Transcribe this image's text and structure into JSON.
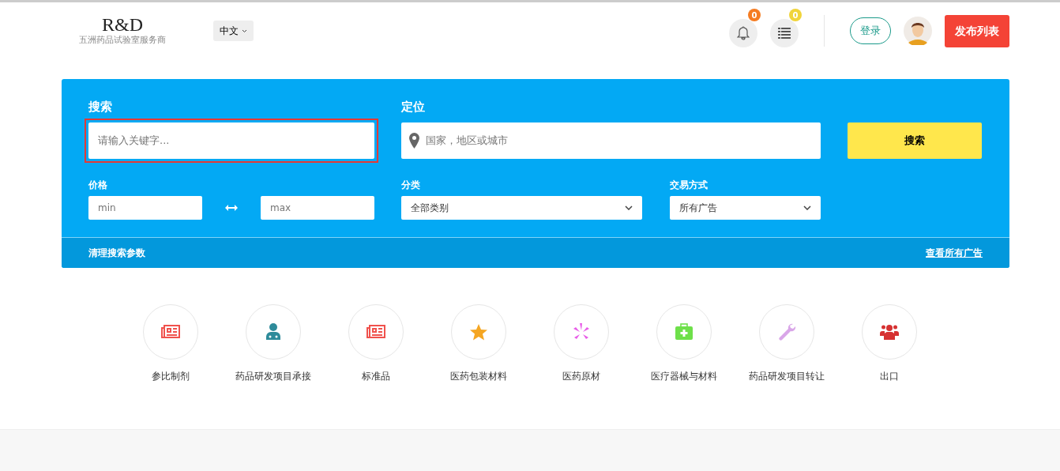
{
  "header": {
    "logo": "R&D",
    "tagline": "五洲药品试验室服务商",
    "language": "中文",
    "notifications": [
      {
        "kind": "bell",
        "count": "0",
        "color": "#f57c22"
      },
      {
        "kind": "list",
        "count": "0",
        "color": "#f0d43a"
      }
    ],
    "login": "登录",
    "publish": "发布列表"
  },
  "search": {
    "keyword_label": "搜索",
    "keyword_placeholder": "请输入关键字...",
    "keyword_focused": true,
    "location_label": "定位",
    "location_placeholder": "国家，地区或城市",
    "button": "搜索",
    "price_label": "价格",
    "min_placeholder": "min",
    "max_placeholder": "max",
    "category_label": "分类",
    "category_value": "全部类别",
    "trade_label": "交易方式",
    "trade_value": "所有广告",
    "clear": "清理搜索参数",
    "view_all": "查看所有广告"
  },
  "categories": [
    {
      "label": "参比制剂",
      "kind": "newspaper",
      "color": "#f0524d"
    },
    {
      "label": "药品研发项目承接",
      "kind": "doctor",
      "color": "#2e8b9a"
    },
    {
      "label": "标准品",
      "kind": "newspaper",
      "color": "#f0524d"
    },
    {
      "label": "医药包装材料",
      "kind": "star",
      "color": "#f5a623"
    },
    {
      "label": "医药原材",
      "kind": "burst",
      "color": "#e85ce8"
    },
    {
      "label": "医疗器械与材料",
      "kind": "medkit",
      "color": "#6ee04a"
    },
    {
      "label": "药品研发项目转让",
      "kind": "wrench",
      "color": "#d9a6e8"
    },
    {
      "label": "出口",
      "kind": "users",
      "color": "#d63232"
    }
  ]
}
